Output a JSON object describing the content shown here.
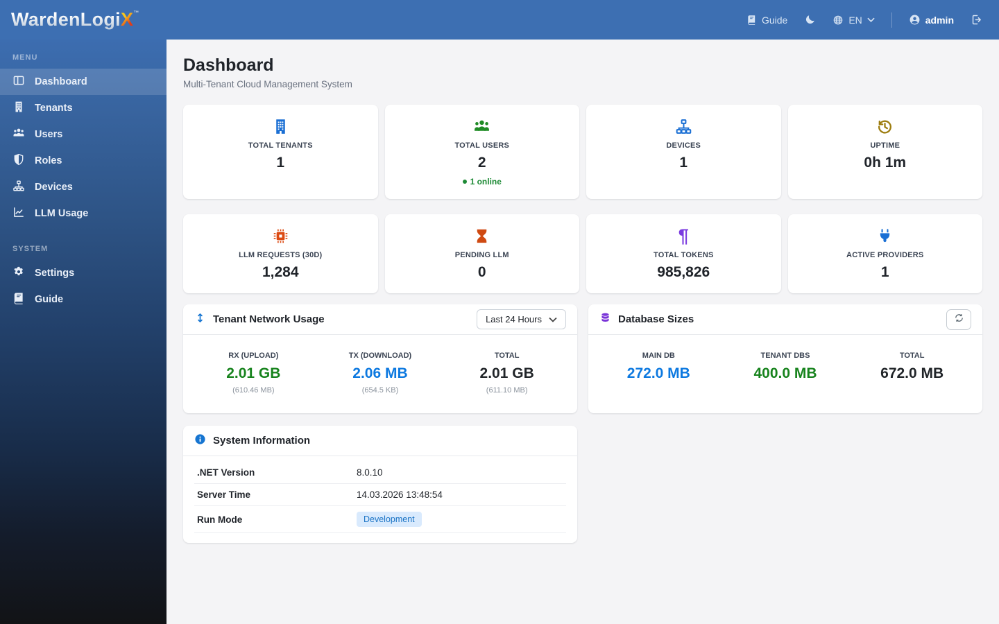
{
  "brand": {
    "name": "WardenLogi",
    "accent": "X",
    "trademark": "™"
  },
  "header": {
    "guide_label": "Guide",
    "language_selected": "EN",
    "username": "admin",
    "icons": [
      "book-icon",
      "moon-icon",
      "globe-icon",
      "caret-down-icon",
      "person-circle-icon",
      "sign-out-icon"
    ]
  },
  "sidebar": {
    "menu_label": "MENU",
    "system_label": "SYSTEM",
    "menu_items": [
      {
        "label": "Dashboard",
        "icon": "columns-icon",
        "active": true
      },
      {
        "label": "Tenants",
        "icon": "building-icon",
        "active": false
      },
      {
        "label": "Users",
        "icon": "users-icon",
        "active": false
      },
      {
        "label": "Roles",
        "icon": "shield-halved-icon",
        "active": false
      },
      {
        "label": "Devices",
        "icon": "sitemap-icon",
        "active": false
      },
      {
        "label": "LLM Usage",
        "icon": "chart-line-icon",
        "active": false
      }
    ],
    "system_items": [
      {
        "label": "Settings",
        "icon": "gear-icon"
      },
      {
        "label": "Guide",
        "icon": "book-icon"
      }
    ]
  },
  "page": {
    "title": "Dashboard",
    "subtitle": "Multi-Tenant Cloud Management System"
  },
  "stat_cards": [
    {
      "label": "TOTAL TENANTS",
      "value": "1",
      "icon": "building-icon",
      "icon_color": "#1a6fd4"
    },
    {
      "label": "TOTAL USERS",
      "value": "2",
      "online": "1 online",
      "icon": "users-icon",
      "icon_color": "#1f8b24"
    },
    {
      "label": "DEVICES",
      "value": "1",
      "icon": "sitemap-icon",
      "icon_color": "#1a6fd4"
    },
    {
      "label": "UPTIME",
      "value": "0h 1m",
      "icon": "history-icon",
      "icon_color": "#9d7d0f"
    },
    {
      "label": "LLM REQUESTS (30D)",
      "value": "1,284",
      "icon": "microchip-icon",
      "icon_color": "#dc4a12"
    },
    {
      "label": "PENDING LLM",
      "value": "0",
      "icon": "hourglass-icon",
      "icon_color": "#cf4a12"
    },
    {
      "label": "TOTAL TOKENS",
      "value": "985,826",
      "icon": "pilcrow-icon",
      "icon_color": "#7b3be0"
    },
    {
      "label": "ACTIVE PROVIDERS",
      "value": "1",
      "icon": "plug-icon",
      "icon_color": "#1a6fd4"
    }
  ],
  "network_usage": {
    "title": "Tenant Network Usage",
    "title_icon": "up-down-arrow-icon",
    "period_selected": "Last 24 Hours",
    "columns": [
      {
        "label": "RX (UPLOAD)",
        "value": "2.01 GB",
        "sub": "(610.46 MB)",
        "color": "#17831d"
      },
      {
        "label": "TX (DOWNLOAD)",
        "value": "2.06 MB",
        "sub": "(654.5 KB)",
        "color": "#0d79e0"
      },
      {
        "label": "TOTAL",
        "value": "2.01 GB",
        "sub": "(611.10 MB)",
        "color": "#212529"
      }
    ]
  },
  "database_sizes": {
    "title": "Database Sizes",
    "title_icon": "database-icon",
    "refresh_icon": "refresh-icon",
    "columns": [
      {
        "label": "MAIN DB",
        "value": "272.0 MB",
        "color": "#0d79e0"
      },
      {
        "label": "TENANT DBS",
        "value": "400.0 MB",
        "color": "#17831d"
      },
      {
        "label": "TOTAL",
        "value": "672.0 MB",
        "color": "#212529"
      }
    ]
  },
  "system_info": {
    "title": "System Information",
    "title_icon": "info-circle-icon",
    "rows": [
      {
        "label": ".NET Version",
        "value": "8.0.10"
      },
      {
        "label": "Server Time",
        "value": "14.03.2026 13:48:54"
      },
      {
        "label": "Run Mode",
        "value": "Development",
        "is_badge": true
      }
    ]
  },
  "colors": {
    "header_bg": "#3d6fb2",
    "content_bg": "#f4f4f6",
    "card_bg": "#ffffff",
    "success_green": "#17831d",
    "info_blue": "#0d79e0",
    "online_green": "#1d8a35",
    "badge_bg": "#d9eafd",
    "badge_text": "#1b74c5"
  }
}
